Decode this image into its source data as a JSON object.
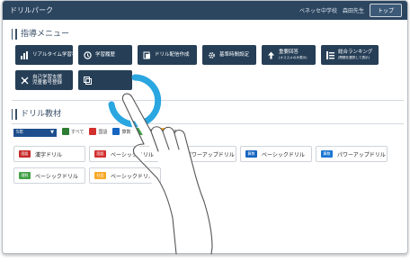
{
  "app": {
    "title": "ドリルパーク",
    "top_right_text": "ベネッセ中学校　森田先生",
    "top_button": "トップ"
  },
  "sections": {
    "menu_title": "指導メニュー",
    "drill_title": "ドリル教材"
  },
  "menu_buttons": [
    {
      "label": "リアルタイム学習状況",
      "icon": "bar-chart-icon"
    },
    {
      "label": "学習履歴",
      "icon": "history-icon"
    },
    {
      "label": "ドリル配信作成",
      "icon": "send-icon"
    },
    {
      "label": "基準時間設定",
      "icon": "gear-icon"
    },
    {
      "label": "重要回答",
      "sublabel": "(オススメのみ表示)",
      "icon": "upload-icon"
    },
    {
      "label": "総合ランキング",
      "sublabel": "(問題を選択して表示)",
      "icon": "list-icon"
    },
    {
      "label": "自己学習支援",
      "sublabel": "児童番号登録",
      "icon": "tools-icon"
    },
    {
      "label": "",
      "icon": "layers-icon"
    }
  ],
  "subject_select": {
    "value": "5年"
  },
  "tabs": [
    {
      "label": "すべて",
      "color": "#2e7d32"
    },
    {
      "label": "国語",
      "color": "#d32f2f"
    },
    {
      "label": "算数",
      "color": "#1565c0"
    },
    {
      "label": "理科",
      "color": "#43a047"
    },
    {
      "label": "社会",
      "color": "#f9a825"
    }
  ],
  "drills": [
    {
      "badge": "国語",
      "label": "漢字ドリル",
      "color": "#c62828"
    },
    {
      "badge": "国語",
      "label": "ベーシックドリル",
      "color": "#d32f2f"
    },
    {
      "badge": "国語",
      "label": "パワーアップドリル",
      "color": "#e57373"
    },
    {
      "badge": "算数",
      "label": "ベーシックドリル",
      "color": "#1565c0"
    },
    {
      "badge": "算数",
      "label": "パワーアップドリル",
      "color": "#1976d2"
    },
    {
      "badge": "理科",
      "label": "ベーシックドリル",
      "color": "#43a047"
    },
    {
      "badge": "社会",
      "label": "ベーシックドリル",
      "color": "#f9a825"
    }
  ],
  "colors": {
    "header": "#2d4660",
    "menu_button": "#263f57",
    "tap_ring": "#2aa6e0"
  }
}
